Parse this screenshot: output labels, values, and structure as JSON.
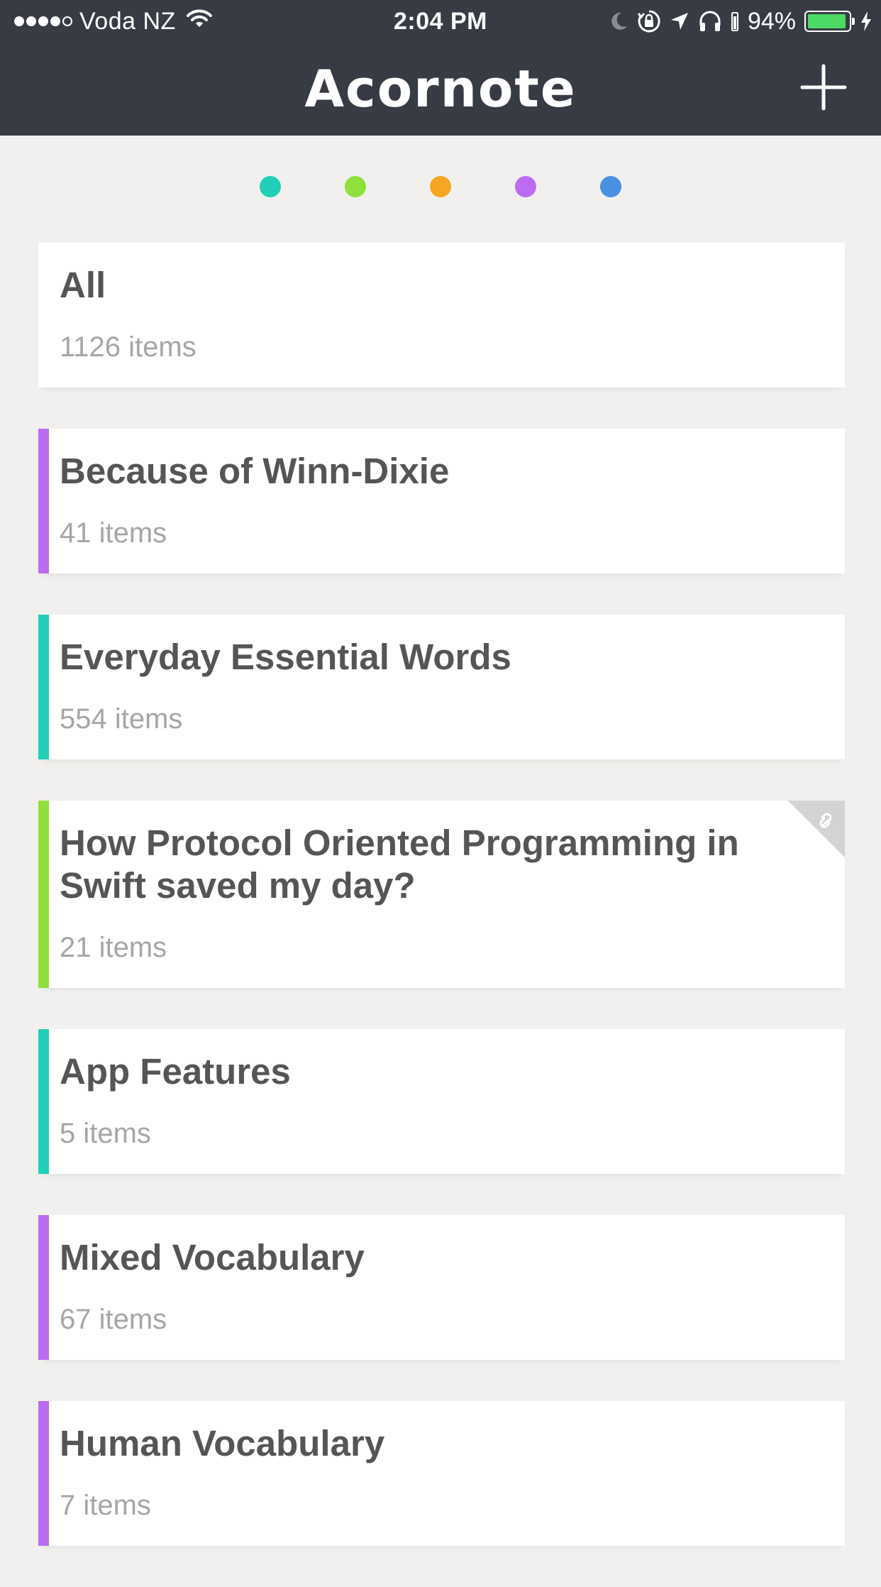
{
  "status_bar": {
    "signal_dots": [
      true,
      true,
      true,
      true,
      false
    ],
    "carrier": "Voda NZ",
    "time": "2:04 PM",
    "battery_percent": "94%",
    "battery_level": 0.94,
    "icons": [
      "wifi-icon",
      "moon-icon",
      "rotation-lock-icon",
      "location-arrow-icon",
      "headphones-icon",
      "battery-icon",
      "charging-bolt-icon"
    ]
  },
  "nav": {
    "title": "Acornote",
    "add_icon": "plus-icon"
  },
  "color_filters": [
    {
      "name": "teal",
      "color": "#1fd0b7"
    },
    {
      "name": "green",
      "color": "#8fe03a"
    },
    {
      "name": "orange",
      "color": "#f5a623"
    },
    {
      "name": "purple",
      "color": "#bb6cf2"
    },
    {
      "name": "blue",
      "color": "#4a90e2"
    }
  ],
  "folders": [
    {
      "title": "All",
      "count": "1126 items",
      "color": null,
      "linked": false
    },
    {
      "title": "Because of Winn-Dixie",
      "count": "41 items",
      "color": "#bb6cf2",
      "linked": false
    },
    {
      "title": "Everyday Essential Words",
      "count": "554 items",
      "color": "#1fd0b7",
      "linked": false
    },
    {
      "title": "How Protocol Oriented Programming in Swift saved my day?",
      "count": "21 items",
      "color": "#8fe03a",
      "linked": true
    },
    {
      "title": "App Features",
      "count": "5 items",
      "color": "#1fd0b7",
      "linked": false
    },
    {
      "title": "Mixed Vocabulary",
      "count": "67 items",
      "color": "#bb6cf2",
      "linked": false
    },
    {
      "title": "Human Vocabulary",
      "count": "7 items",
      "color": "#bb6cf2",
      "linked": false
    }
  ]
}
